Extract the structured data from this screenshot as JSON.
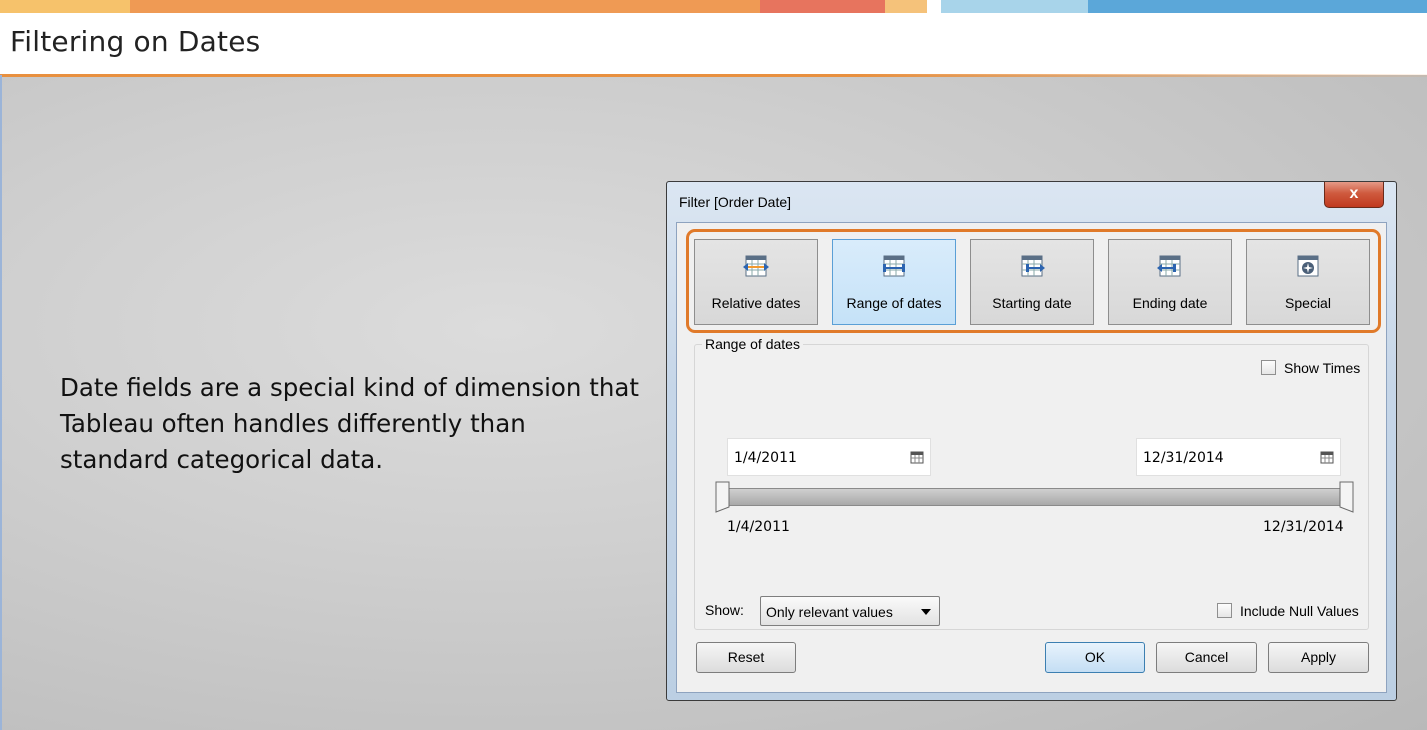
{
  "slide": {
    "title": "Filtering on Dates",
    "body_text": "Date fields are a special kind of dimension that Tableau often handles differently than standard categorical data."
  },
  "colors": {
    "stripe": [
      "#f6c26b",
      "#ef9a54",
      "#e7745e",
      "#f5c27a",
      "#a8d4ea",
      "#5ba7d9"
    ],
    "accent_orange": "#e07a2a"
  },
  "dialog": {
    "title": "Filter [Order Date]",
    "close_label": "x",
    "modes": [
      {
        "label": "Relative dates",
        "icon": "relative-dates-icon",
        "selected": false
      },
      {
        "label": "Range of dates",
        "icon": "range-of-dates-icon",
        "selected": true
      },
      {
        "label": "Starting date",
        "icon": "starting-date-icon",
        "selected": false
      },
      {
        "label": "Ending date",
        "icon": "ending-date-icon",
        "selected": false
      },
      {
        "label": "Special",
        "icon": "special-icon",
        "selected": false
      }
    ],
    "range_group_label": "Range of dates",
    "show_times_label": "Show Times",
    "start_date_value": "1/4/2011",
    "end_date_value": "12/31/2014",
    "slider_min_label": "1/4/2011",
    "slider_max_label": "12/31/2014",
    "show_label": "Show:",
    "show_select_value": "Only relevant values",
    "include_null_label": "Include Null Values",
    "buttons": {
      "reset": "Reset",
      "ok": "OK",
      "cancel": "Cancel",
      "apply": "Apply"
    }
  }
}
